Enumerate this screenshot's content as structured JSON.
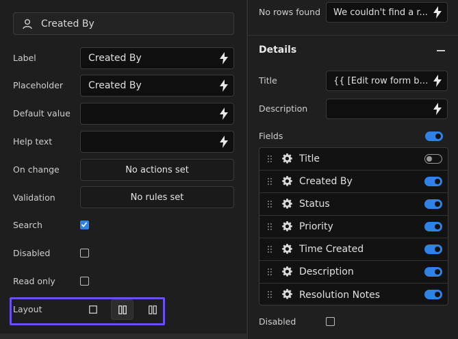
{
  "group": {
    "title": "Created By",
    "icon": "user-icon"
  },
  "left_rows": [
    {
      "label": "Label",
      "value": "Created By"
    },
    {
      "label": "Placeholder",
      "value": "Created By"
    },
    {
      "label": "Default value",
      "value": ""
    },
    {
      "label": "Help text",
      "value": ""
    }
  ],
  "on_change": {
    "label": "On change",
    "button": "No actions set"
  },
  "validation": {
    "label": "Validation",
    "button": "No rules set"
  },
  "search": {
    "label": "Search",
    "checked": true
  },
  "disabled": {
    "label": "Disabled",
    "checked": false
  },
  "read_only": {
    "label": "Read only",
    "checked": false
  },
  "layout": {
    "label": "Layout",
    "options": [
      "single-column",
      "two-column",
      "two-column-compact"
    ],
    "selected": "two-column"
  },
  "right": {
    "no_rows": {
      "label": "No rows found",
      "value": "We couldn't find a r..."
    },
    "details_title": "Details",
    "title": {
      "label": "Title",
      "value": "{{ [Edit row form blo..."
    },
    "description": {
      "label": "Description",
      "value": ""
    },
    "fields_label": "Fields",
    "fields_toggle": true,
    "fields": [
      {
        "name": "Title",
        "enabled": false
      },
      {
        "name": "Created By",
        "enabled": true
      },
      {
        "name": "Status",
        "enabled": true
      },
      {
        "name": "Priority",
        "enabled": true
      },
      {
        "name": "Time Created",
        "enabled": true
      },
      {
        "name": "Description",
        "enabled": true
      },
      {
        "name": "Resolution Notes",
        "enabled": true
      }
    ],
    "disabled_label": "Disabled"
  },
  "colors": {
    "accent": "#2f83e6",
    "highlight": "#6a4ff2"
  }
}
